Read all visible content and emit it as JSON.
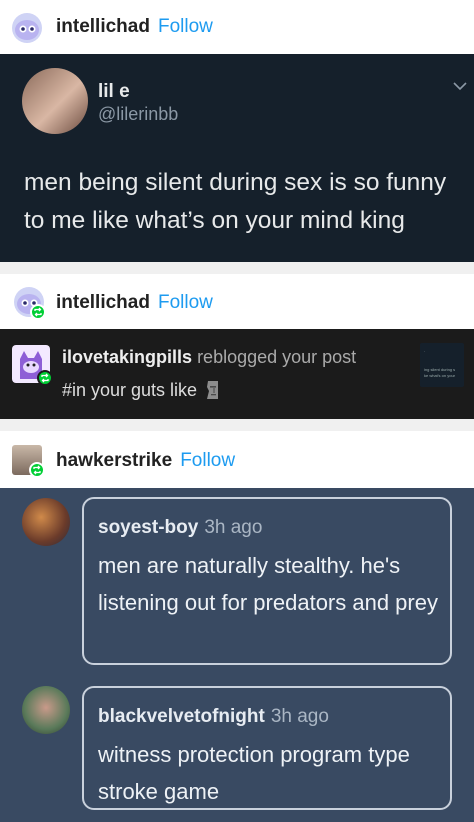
{
  "post1": {
    "username": "intellichad",
    "follow_label": "Follow",
    "tweet": {
      "display_name": "lil e",
      "handle": "@lilerinbb",
      "text": "men being silent during sex is so funny to me like what’s on your mind king"
    }
  },
  "post2": {
    "username": "intellichad",
    "follow_label": "Follow",
    "notification": {
      "user": "ilovetakingpills",
      "action": "reblogged your post",
      "tags": "#in your guts like"
    }
  },
  "post3": {
    "username": "hawkerstrike",
    "follow_label": "Follow",
    "replies": [
      {
        "user": "soyest-boy",
        "time": "3h ago",
        "text": "men are naturally stealthy. he's listening out for predators and prey"
      },
      {
        "user": "blackvelvetofnight",
        "time": "3h ago",
        "text": "witness protection program type stroke game"
      }
    ]
  },
  "colors": {
    "follow": "#1d9bf0",
    "tweet_bg": "#15202b",
    "notification_bg": "#1b1b1b",
    "thread_bg": "#394a62",
    "reblog_badge": "#00cf35"
  }
}
